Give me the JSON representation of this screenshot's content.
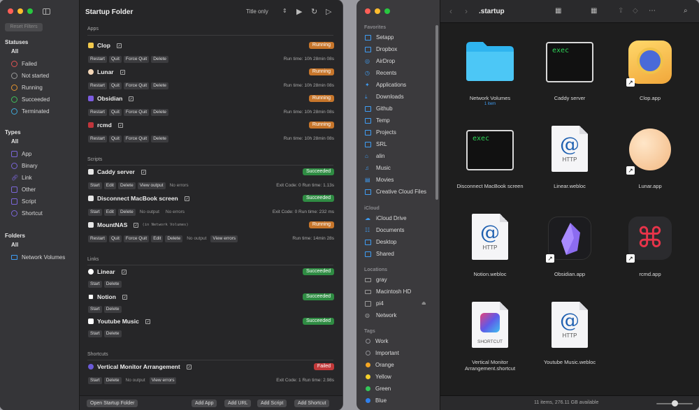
{
  "app": {
    "title": "Startup Folder",
    "sort_mode": "Title only",
    "reset_filters": "Reset Filters",
    "filters": {
      "statuses_title": "Statuses",
      "statuses_all": "All",
      "statuses": [
        "Failed",
        "Not started",
        "Running",
        "Succeeded",
        "Terminated"
      ],
      "types_title": "Types",
      "types_all": "All",
      "types": [
        "App",
        "Binary",
        "Link",
        "Other",
        "Script",
        "Shortcut"
      ],
      "folders_title": "Folders",
      "folders_all": "All",
      "folders": [
        "Network Volumes"
      ]
    },
    "sections": {
      "apps": "Apps",
      "scripts": "Scripts",
      "links": "Links",
      "shortcuts": "Shortcuts"
    },
    "apps": [
      {
        "name": "Clop",
        "status": "Running",
        "buttons": [
          "Restart",
          "Quit",
          "Force Quit",
          "Delete"
        ],
        "meta": "Run time: 10h 28min 08s"
      },
      {
        "name": "Lunar",
        "status": "Running",
        "buttons": [
          "Restart",
          "Quit",
          "Force Quit",
          "Delete"
        ],
        "meta": "Run time: 10h 28min 08s"
      },
      {
        "name": "Obsidian",
        "status": "Running",
        "buttons": [
          "Restart",
          "Quit",
          "Force Quit",
          "Delete"
        ],
        "meta": "Run time: 10h 28min 08s"
      },
      {
        "name": "rcmd",
        "status": "Running",
        "buttons": [
          "Restart",
          "Quit",
          "Force Quit",
          "Delete"
        ],
        "meta": "Run time: 10h 28min 08s"
      }
    ],
    "scripts": [
      {
        "name": "Caddy server",
        "status": "Succeeded",
        "buttons": [
          "Start",
          "Edit",
          "Delete",
          "View output"
        ],
        "note": "No errors",
        "meta": "Exit Code: 0   Run time: 1.13s"
      },
      {
        "name": "Disconnect MacBook screen",
        "status": "Succeeded",
        "buttons": [
          "Start",
          "Edit",
          "Delete"
        ],
        "note": "No output",
        "note2": "No errors",
        "meta": "Exit Code: 0   Run time: 232 ms"
      },
      {
        "name": "MountNAS",
        "extra": "(in Network Volumes)",
        "status": "Running",
        "buttons": [
          "Restart",
          "Quit",
          "Force Quit",
          "Edit",
          "Delete"
        ],
        "note": "No output",
        "button_last": "View errors",
        "meta": "Run time: 14min 28s"
      }
    ],
    "links": [
      {
        "name": "Linear",
        "status": "Succeeded",
        "buttons": [
          "Start",
          "Delete"
        ]
      },
      {
        "name": "Notion",
        "status": "Succeeded",
        "buttons": [
          "Start",
          "Delete"
        ]
      },
      {
        "name": "Youtube Music",
        "status": "Succeeded",
        "buttons": [
          "Start",
          "Delete"
        ]
      }
    ],
    "shortcuts": [
      {
        "name": "Vertical Monitor Arrangement",
        "status": "Failed",
        "buttons": [
          "Start",
          "Delete"
        ],
        "note": "No output",
        "button_last": "View errors",
        "meta": "Exit Code: 1   Run time: 2.98s"
      }
    ],
    "bottom": {
      "open": "Open Startup Folder",
      "add_app": "Add App",
      "add_url": "Add URL",
      "add_script": "Add Script",
      "add_shortcut": "Add Shortcut"
    },
    "colors": {
      "running": "#c7762b",
      "succeeded": "#2f8c43",
      "failed": "#c2393a"
    }
  },
  "finder": {
    "title": ".startup",
    "sidebar": {
      "favorites_title": "Favorites",
      "favorites": [
        "Setapp",
        "Dropbox",
        "AirDrop",
        "Recents",
        "Applications",
        "Downloads",
        "Github",
        "Temp",
        "Projects",
        "SRL",
        "alin",
        "Music",
        "Movies",
        "Creative Cloud Files"
      ],
      "icloud_title": "iCloud",
      "icloud": [
        "iCloud Drive",
        "Documents",
        "Desktop",
        "Shared"
      ],
      "locations_title": "Locations",
      "locations": [
        "gray",
        "Macintosh HD",
        "pi4",
        "Network"
      ],
      "tags_title": "Tags",
      "tags": [
        {
          "name": "Work",
          "color": "#8e8e93"
        },
        {
          "name": "Important",
          "color": "#8e8e93"
        },
        {
          "name": "Orange",
          "color": "#f5a623"
        },
        {
          "name": "Yellow",
          "color": "#f3d02c"
        },
        {
          "name": "Green",
          "color": "#34c759"
        },
        {
          "name": "Blue",
          "color": "#2f80ed"
        }
      ]
    },
    "items": {
      "network_volumes": "Network Volumes",
      "network_volumes_sub": "1 item",
      "caddy": "Caddy server",
      "clop": "Clop.app",
      "disconnect": "Disconnect MacBook screen",
      "linear": "Linear.webloc",
      "lunar": "Lunar.app",
      "notion": "Notion.webloc",
      "obsidian": "Obsidian.app",
      "rcmd": "rcmd.app",
      "vertical": "Vertical Monitor Arrangement.shortcut",
      "youtube": "Youtube Music.webloc"
    },
    "exec_label": "exec",
    "http_label": "HTTP",
    "at_label": "@",
    "shortcut_label": "SHORTCUT",
    "status": "11 items, 276.11 GB available"
  }
}
